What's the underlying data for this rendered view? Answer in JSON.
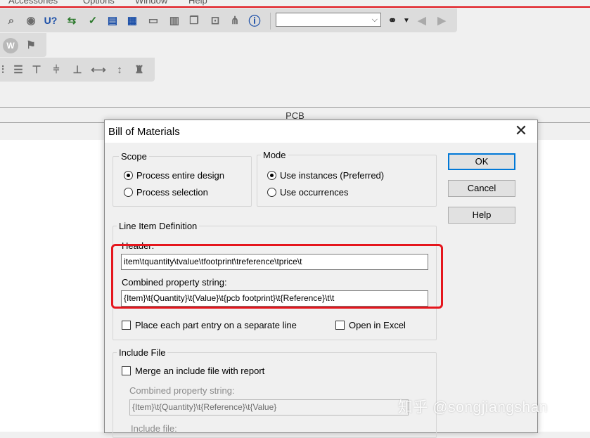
{
  "menubar": {
    "items": [
      "Accessories",
      "Options",
      "Window",
      "Help"
    ]
  },
  "toolbar": {
    "row1_icons": [
      "zoom-icon",
      "eye-icon",
      "u-question-icon",
      "annotate-icon",
      "check-icon",
      "page-icon",
      "grid-icon",
      "document-icon",
      "boxes-icon",
      "copy-icon",
      "hierarchy-icon",
      "tree-icon",
      "help-icon"
    ],
    "search_value": "",
    "row2_icons": [
      "w-icon",
      "flag-icon"
    ],
    "row3_icons": [
      "align-left-icon",
      "align-top-icon",
      "align-center-icon",
      "align-bottom-icon",
      "distribute-icon",
      "align-horizontal-icon",
      "align-vertical-icon",
      "stamp-icon"
    ]
  },
  "pcb_strip": {
    "title": "PCB"
  },
  "dialog": {
    "title": "Bill of Materials",
    "scope": {
      "legend": "Scope",
      "options": [
        "Process entire design",
        "Process selection"
      ],
      "selected": 0
    },
    "mode": {
      "legend": "Mode",
      "options": [
        "Use instances (Preferred)",
        "Use occurrences"
      ],
      "selected": 0
    },
    "line_item": {
      "legend": "Line Item Definition",
      "header_label": "Header:",
      "header_value": "item\\tquantity\\tvalue\\tfootprint\\treference\\tprice\\t",
      "combined_label": "Combined property string:",
      "combined_value": "{Item}\\t{Quantity}\\t{Value}\\t{pcb footprint}\\t{Reference}\\t\\t",
      "separate_line_label": "Place each part entry on a separate line",
      "excel_label": "Open in Excel"
    },
    "include_file": {
      "legend": "Include File",
      "merge_label": "Merge an include file with report",
      "combined_label": "Combined property string:",
      "combined_value": "{Item}\\t{Quantity}\\t{Reference}\\t{Value}",
      "include_file_label": "Include file:"
    },
    "buttons": {
      "ok": "OK",
      "cancel": "Cancel",
      "help": "Help"
    }
  },
  "watermark": "知乎 @songjiangshan"
}
